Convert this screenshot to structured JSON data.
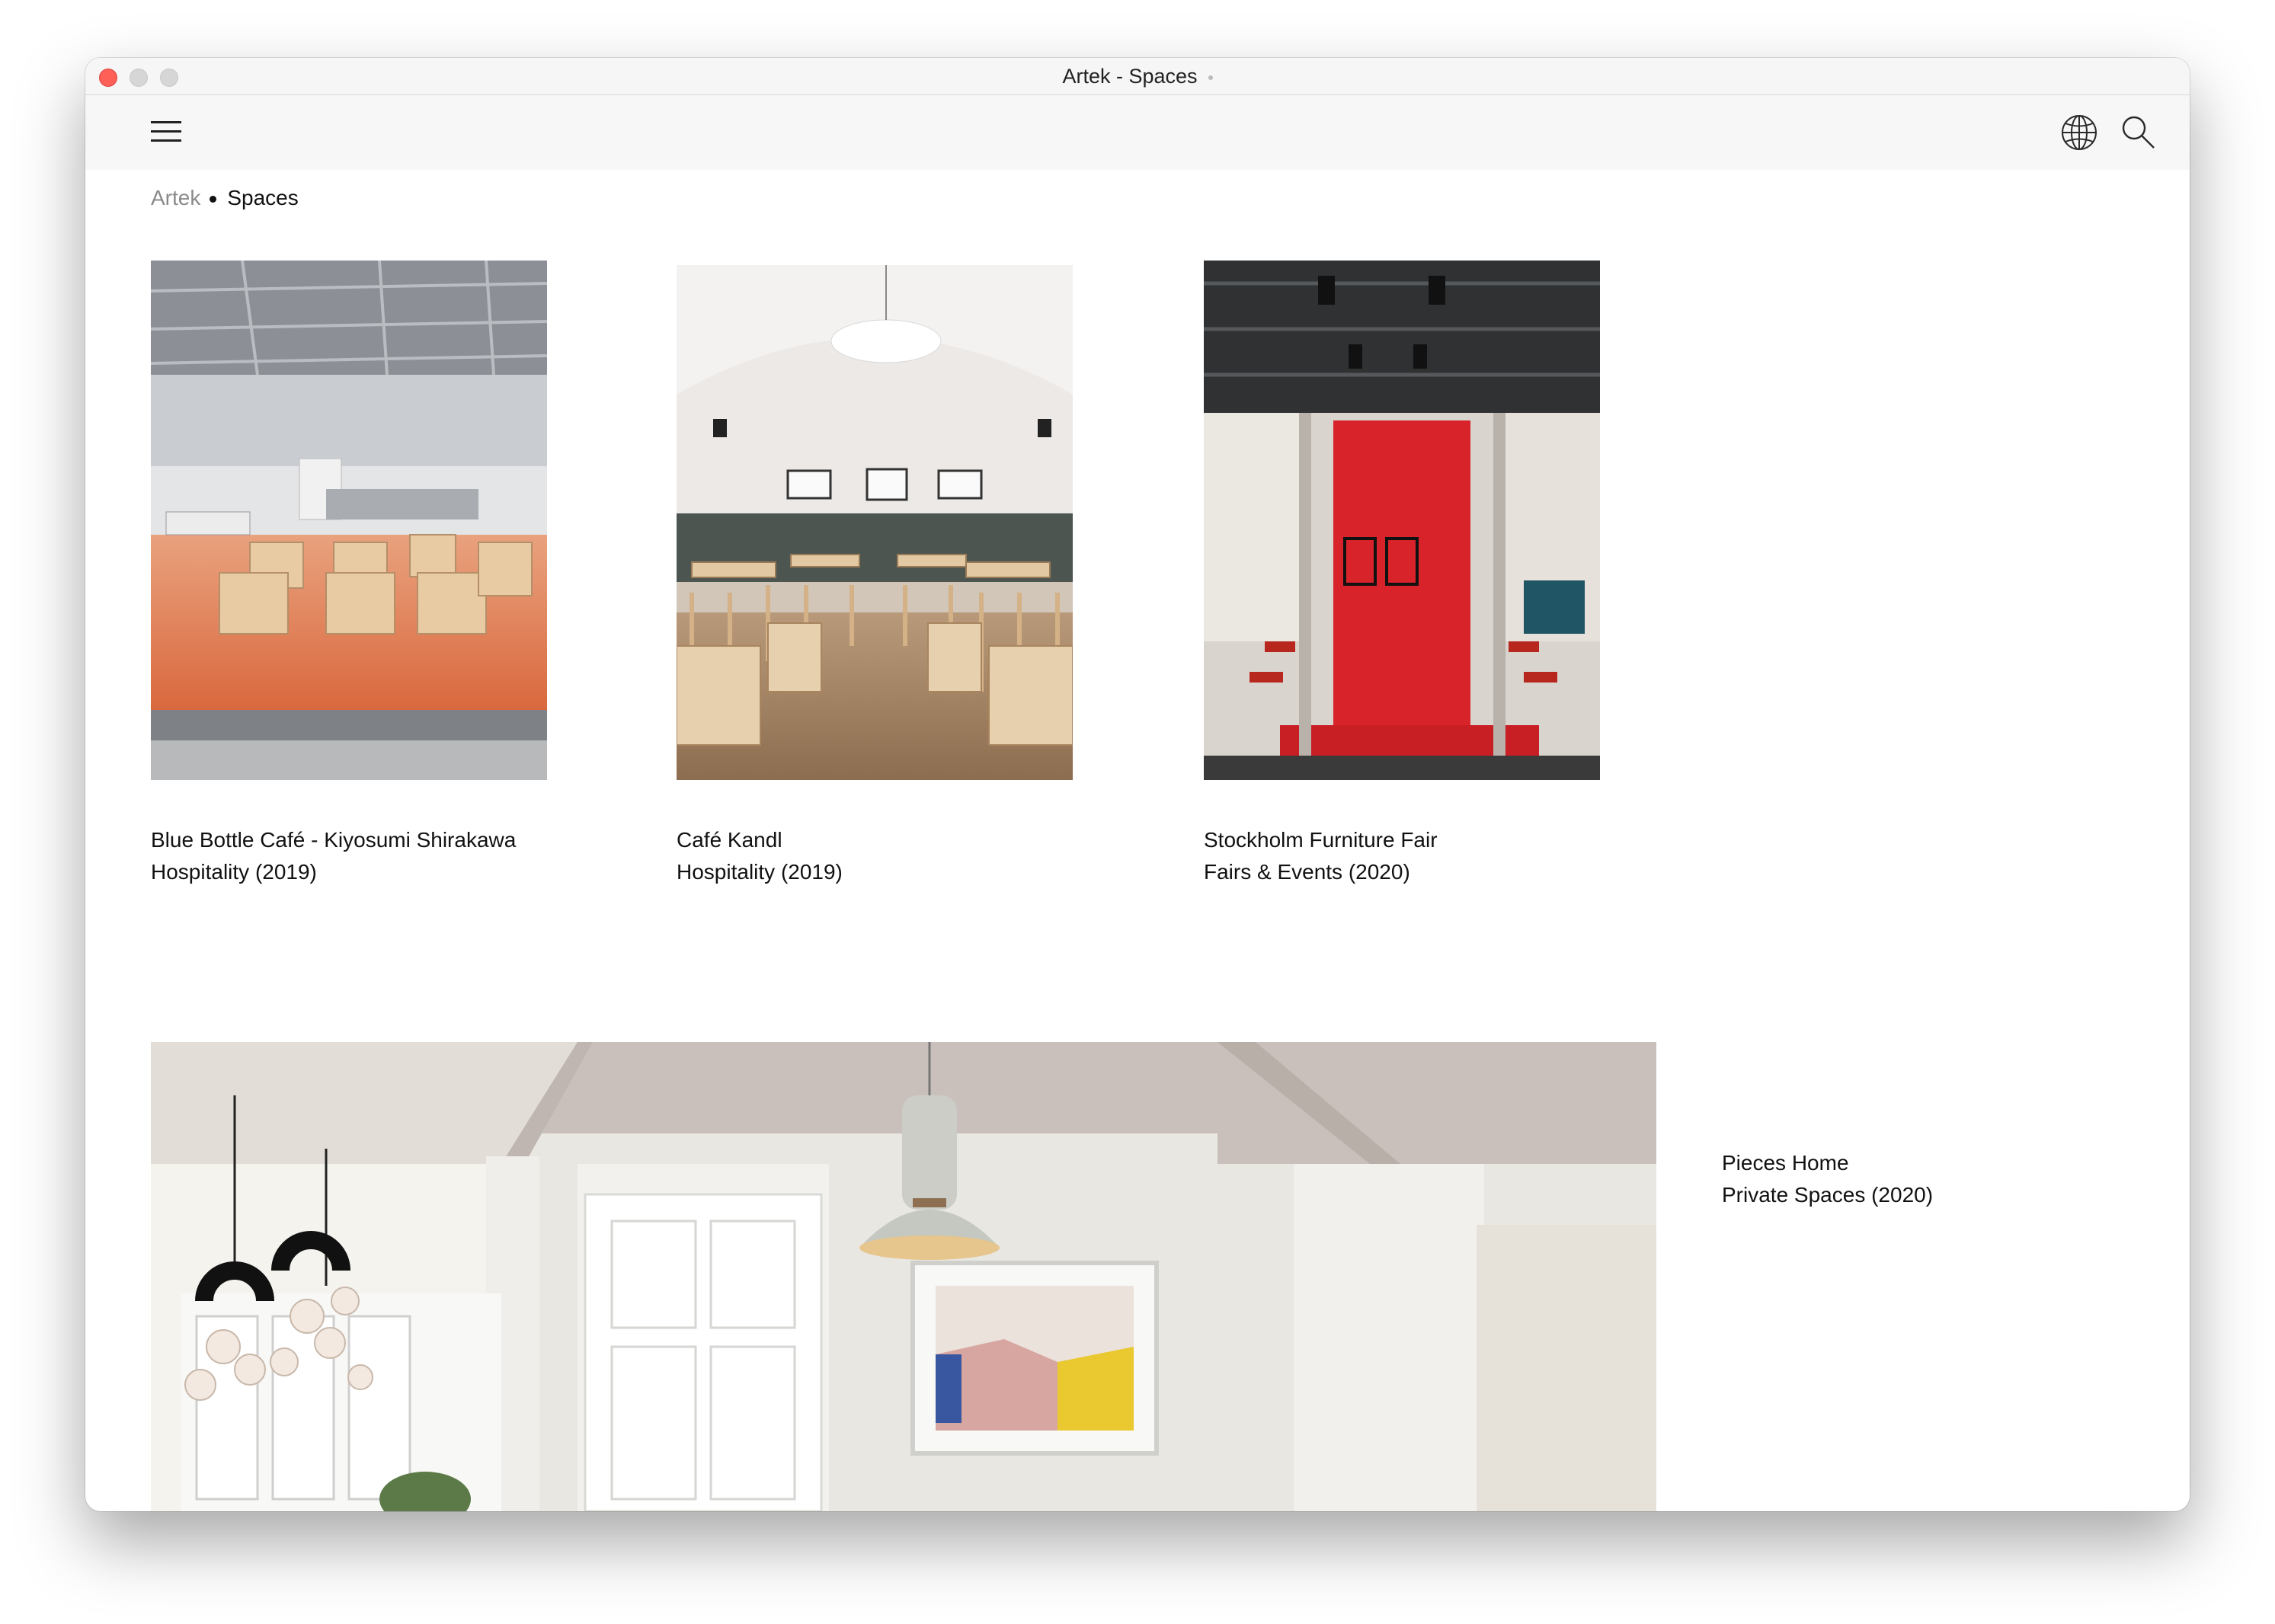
{
  "window": {
    "title": "Artek - Spaces"
  },
  "header": {
    "menu_icon": "hamburger-menu-icon",
    "language_icon": "globe-icon",
    "search_icon": "search-icon"
  },
  "breadcrumb": {
    "items": [
      "Artek",
      "Spaces"
    ]
  },
  "spaces": [
    {
      "name": "Blue Bottle Café - Kiyosumi Shirakawa",
      "meta": "Hospitality (2019)"
    },
    {
      "name": "Café Kandl",
      "meta": "Hospitality (2019)"
    },
    {
      "name": "Stockholm Furniture Fair",
      "meta": "Fairs & Events (2020)"
    },
    {
      "name": "Pieces Home",
      "meta": "Private Spaces (2020)"
    }
  ],
  "colors": {
    "close_button": "#fe5f57",
    "header_bg": "#f7f7f7",
    "text": "#111111",
    "muted": "#8a8a8a"
  }
}
